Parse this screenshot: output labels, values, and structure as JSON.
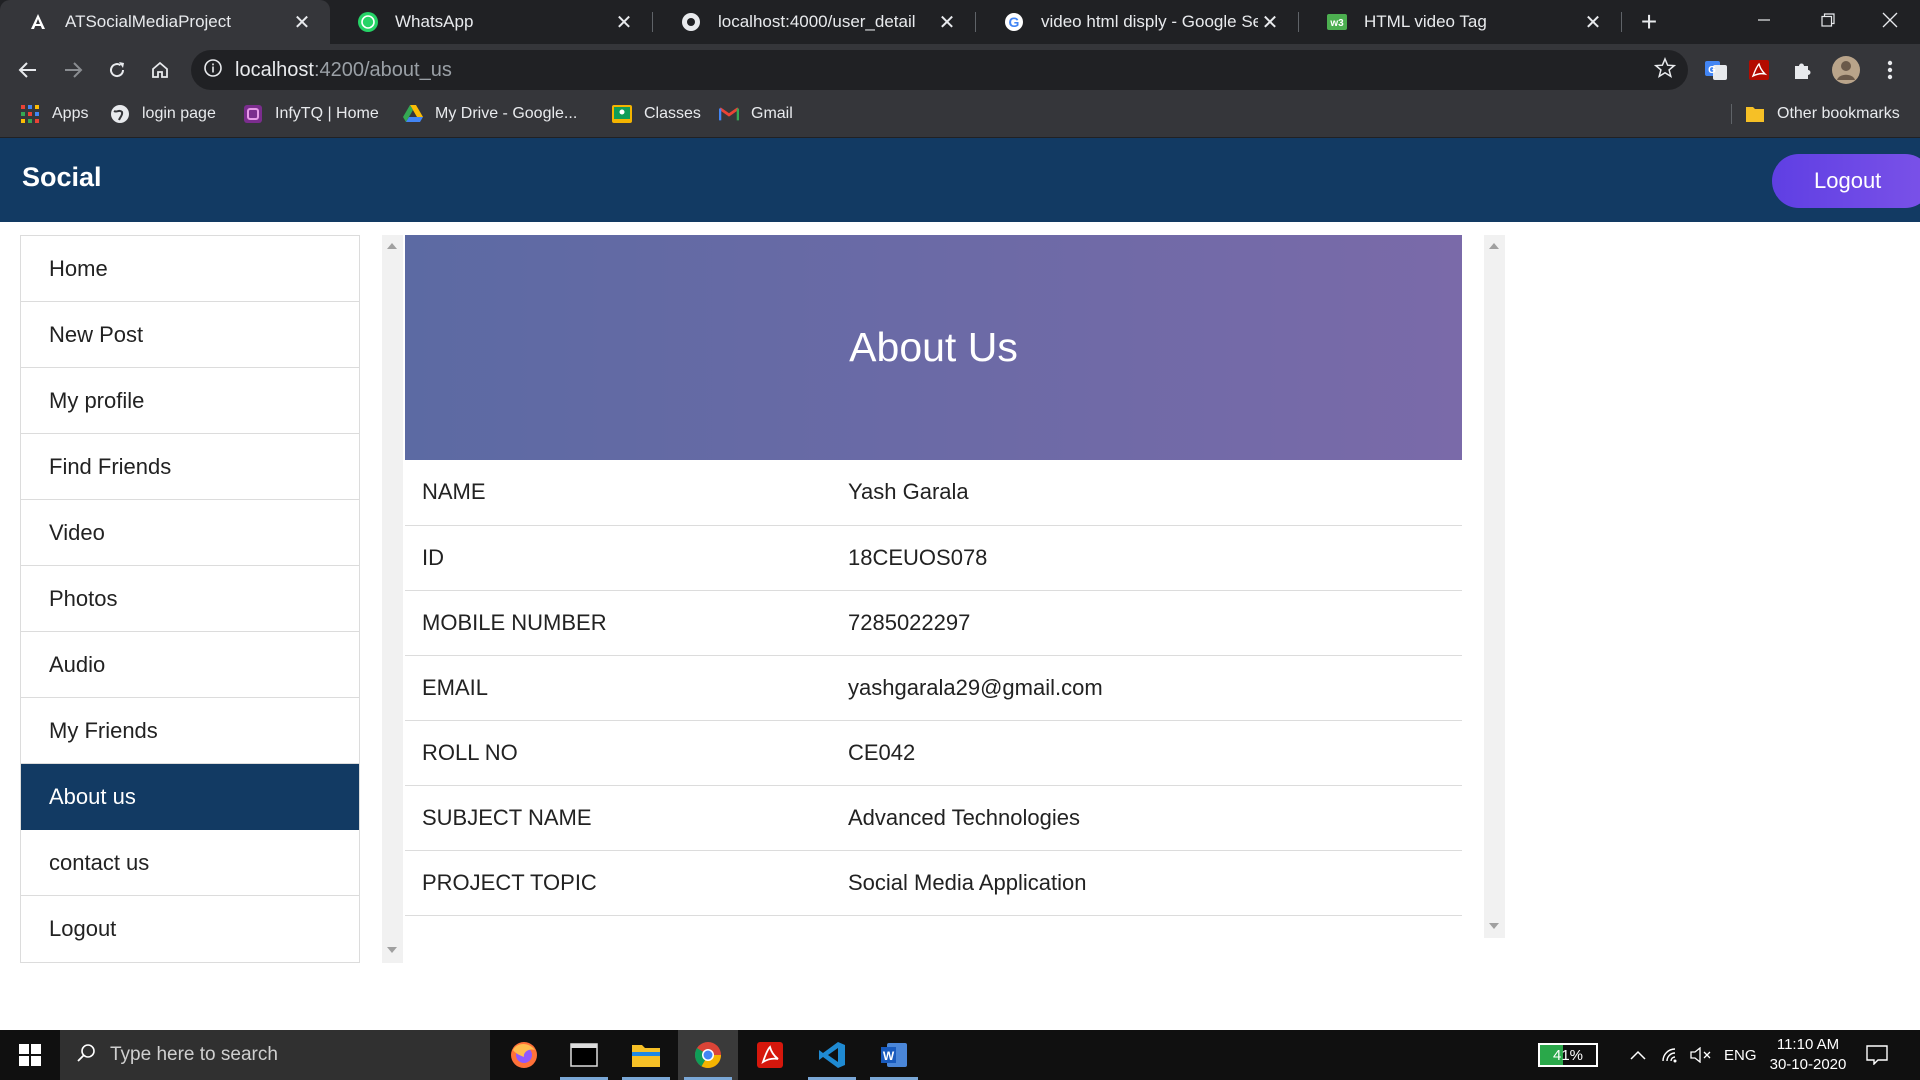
{
  "browser": {
    "tabs": [
      {
        "title": "ATSocialMediaProject",
        "icon": "angular-icon",
        "active": true
      },
      {
        "title": "WhatsApp",
        "icon": "whatsapp-icon",
        "active": false
      },
      {
        "title": "localhost:4000/user_detail",
        "icon": "globe-icon",
        "active": false
      },
      {
        "title": "video html disply - Google Searc",
        "icon": "google-icon",
        "active": false
      },
      {
        "title": "HTML video Tag",
        "icon": "w3schools-icon",
        "active": false
      }
    ],
    "url_host": "localhost",
    "url_path": ":4200/about_us",
    "bookmarks": [
      {
        "label": "Apps",
        "icon": "apps-grid-icon"
      },
      {
        "label": "login page",
        "icon": "globe-icon"
      },
      {
        "label": "InfyTQ | Home",
        "icon": "infytq-icon"
      },
      {
        "label": "My Drive - Google...",
        "icon": "google-drive-icon"
      },
      {
        "label": "Classes",
        "icon": "classroom-icon"
      },
      {
        "label": "Gmail",
        "icon": "gmail-icon"
      }
    ],
    "other_bookmarks": "Other bookmarks"
  },
  "app": {
    "brand": "Social",
    "logout_label": "Logout",
    "sidebar": [
      {
        "label": "Home",
        "active": false
      },
      {
        "label": "New Post",
        "active": false
      },
      {
        "label": "My profile",
        "active": false
      },
      {
        "label": "Find Friends",
        "active": false
      },
      {
        "label": "Video",
        "active": false
      },
      {
        "label": "Photos",
        "active": false
      },
      {
        "label": "Audio",
        "active": false
      },
      {
        "label": "My Friends",
        "active": false
      },
      {
        "label": "About us",
        "active": true
      },
      {
        "label": "contact us",
        "active": false
      },
      {
        "label": "Logout",
        "active": false
      }
    ],
    "about": {
      "title": "About Us",
      "rows": [
        {
          "key": "NAME",
          "value": "Yash Garala"
        },
        {
          "key": "ID",
          "value": "18CEUOS078"
        },
        {
          "key": "MOBILE NUMBER",
          "value": "7285022297"
        },
        {
          "key": "EMAIL",
          "value": "yashgarala29@gmail.com"
        },
        {
          "key": "ROLL NO",
          "value": "CE042"
        },
        {
          "key": "SUBJECT NAME",
          "value": "Advanced Technologies"
        },
        {
          "key": "PROJECT TOPIC",
          "value": "Social Media Application"
        }
      ]
    }
  },
  "taskbar": {
    "search_placeholder": "Type here to search",
    "apps": [
      "firefox-icon",
      "terminal-icon",
      "file-explorer-icon",
      "chrome-icon",
      "acrobat-icon",
      "vscode-icon",
      "word-icon"
    ],
    "battery": "41%",
    "battery_level": 0.41,
    "language": "ENG",
    "time": "11:10 AM",
    "date": "30-10-2020"
  },
  "colors": {
    "header": "#123a63",
    "active_nav": "#123a63",
    "logout_button": "#6a48e6",
    "hero_start": "#5c6aa3",
    "hero_end": "#7a6aa9"
  }
}
